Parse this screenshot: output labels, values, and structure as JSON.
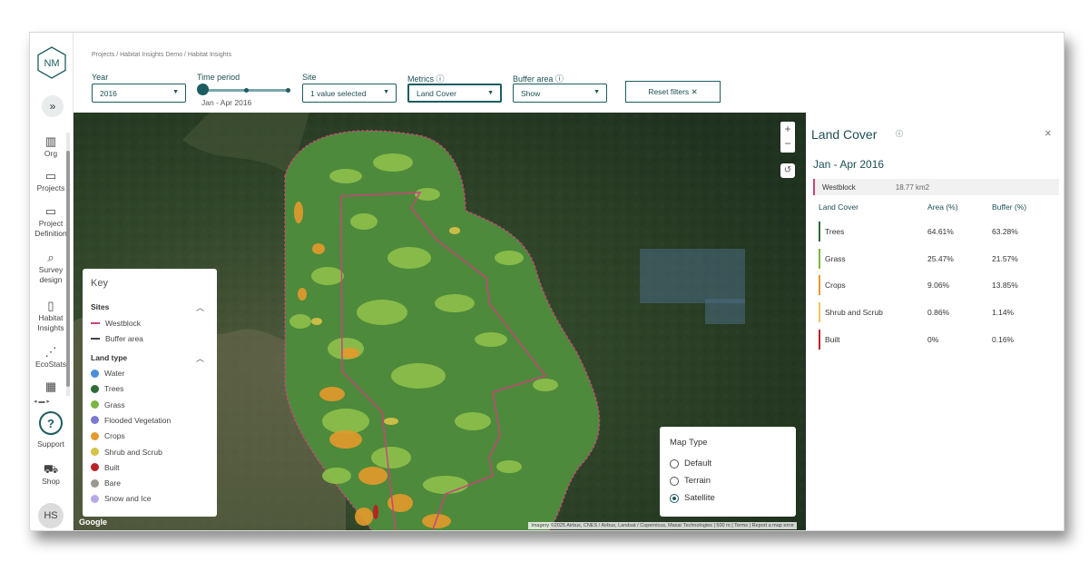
{
  "app": {
    "logo_text": "NM",
    "avatar_initials": "HS"
  },
  "sidebar": {
    "expand_icon": "double-chevron-right-icon",
    "items": [
      {
        "label": "Org",
        "icon": "building-icon"
      },
      {
        "label": "Projects",
        "icon": "folder-icon"
      },
      {
        "label": "Project Definition",
        "icon": "folder-icon"
      },
      {
        "label": "Survey design",
        "icon": "clipboard-search-icon"
      },
      {
        "label": "Habitat Insights",
        "icon": "book-icon"
      },
      {
        "label": "EcoStats",
        "icon": "chart-line-icon"
      },
      {
        "label": "",
        "icon": "grid-icon"
      }
    ],
    "support_label": "Support",
    "support_glyph": "?",
    "shop_label": "Shop"
  },
  "breadcrumb": "Projects / Habitat Insights Demo / Habitat Insights",
  "filters": {
    "year_label": "Year",
    "year_value": "2016",
    "time_period_label": "Time period",
    "time_period_value": "Jan - Apr 2016",
    "site_label": "Site",
    "site_value": "1 value selected",
    "metrics_label": "Metrics",
    "metrics_value": "Land Cover",
    "buffer_label": "Buffer area",
    "buffer_value": "Show",
    "reset_label": "Reset filters"
  },
  "map": {
    "zoom_in": "+",
    "zoom_out": "−",
    "key": {
      "title": "Key",
      "sites_heading": "Sites",
      "sites": [
        {
          "label": "Westblock",
          "color": "#c8457a",
          "style": "line"
        },
        {
          "label": "Buffer area",
          "color": "#444444",
          "style": "dash"
        }
      ],
      "land_heading": "Land type",
      "land_types": [
        {
          "label": "Water",
          "color": "#4a8fd6"
        },
        {
          "label": "Trees",
          "color": "#2e6b35"
        },
        {
          "label": "Grass",
          "color": "#7db544"
        },
        {
          "label": "Flooded Vegetation",
          "color": "#7b79d0"
        },
        {
          "label": "Crops",
          "color": "#e39a2c"
        },
        {
          "label": "Shrub and Scrub",
          "color": "#d8c247"
        },
        {
          "label": "Built",
          "color": "#b82424"
        },
        {
          "label": "Bare",
          "color": "#9c9890"
        },
        {
          "label": "Snow and Ice",
          "color": "#b7a9e8"
        }
      ]
    },
    "map_type": {
      "title": "Map Type",
      "options": [
        "Default",
        "Terrain",
        "Satellite"
      ],
      "selected": "Satellite"
    },
    "google_label": "Google",
    "attribution": "Imagery ©2025 Airbus, CNES / Airbus, Landsat / Copernicus, Maxar Technologies | 500 m | Terms | Report a map error"
  },
  "panel": {
    "title": "Land Cover",
    "close": "×",
    "period": "Jan - Apr 2016",
    "site_name": "Westblock",
    "site_area": "18.77 km2",
    "columns": [
      "Land Cover",
      "Area (%)",
      "Buffer (%)"
    ],
    "rows": [
      {
        "name": "Trees",
        "area": "64.61%",
        "buffer": "63.28%",
        "color": "#2e6b35"
      },
      {
        "name": "Grass",
        "area": "25.47%",
        "buffer": "21.57%",
        "color": "#7db544"
      },
      {
        "name": "Crops",
        "area": "9.06%",
        "buffer": "13.85%",
        "color": "#e39a2c"
      },
      {
        "name": "Shrub and Scrub",
        "area": "0.86%",
        "buffer": "1.14%",
        "color": "#e8c95a"
      },
      {
        "name": "Built",
        "area": "0%",
        "buffer": "0.16%",
        "color": "#b82424"
      }
    ]
  }
}
